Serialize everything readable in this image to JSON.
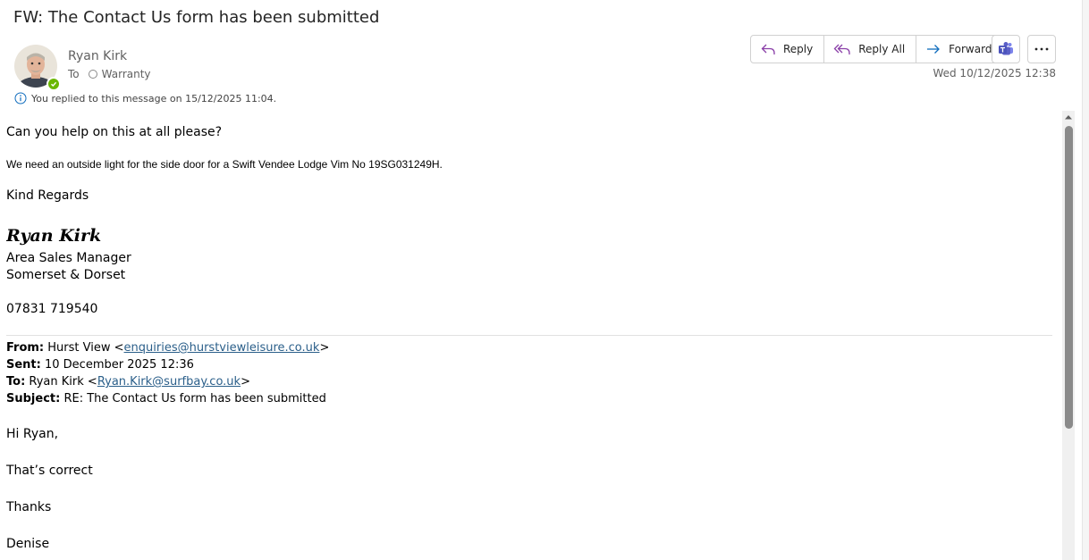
{
  "header": {
    "subject": "FW: The Contact Us form has been submitted",
    "sender_name": "Ryan Kirk",
    "to_label": "To",
    "recipient": "Warranty",
    "info_text": "You replied to this message on 15/12/2025 11:04.",
    "date": "Wed 10/12/2025 12:38"
  },
  "actions": {
    "reply": "Reply",
    "reply_all": "Reply All",
    "forward": "Forward",
    "teams_icon": "teams-icon",
    "more_icon": "more-icon"
  },
  "colors": {
    "reply_icon": "#8a3fa8",
    "forward_icon": "#0f6cbd",
    "presence": "#6bb700",
    "teams": "#5b5fc7"
  },
  "body": {
    "line1": "Can you help on this at all please?",
    "line2": "We need an outside light for the side door for a Swift Vendee Lodge Vim No 19SG031249H.",
    "line3": "Kind Regards",
    "signature": "Ryan Kirk",
    "title": "Area Sales Manager",
    "region": "Somerset & Dorset",
    "phone": "07831 719540"
  },
  "forwarded": {
    "from_label": "From:",
    "from_name": "Hurst View <",
    "from_email": "enquiries@hurstviewleisure.co.uk",
    "from_close": ">",
    "sent_label": "Sent:",
    "sent_value": "10 December 2025 12:36",
    "to_label": "To:",
    "to_name": "Ryan Kirk <",
    "to_email": "Ryan.Kirk@surfbay.co.uk",
    "to_close": ">",
    "subject_label": "Subject:",
    "subject_value": "RE: The Contact Us form has been submitted",
    "greeting": "Hi Ryan,",
    "reply1": "That’s correct",
    "reply2": "Thanks",
    "reply3": "Denise"
  }
}
